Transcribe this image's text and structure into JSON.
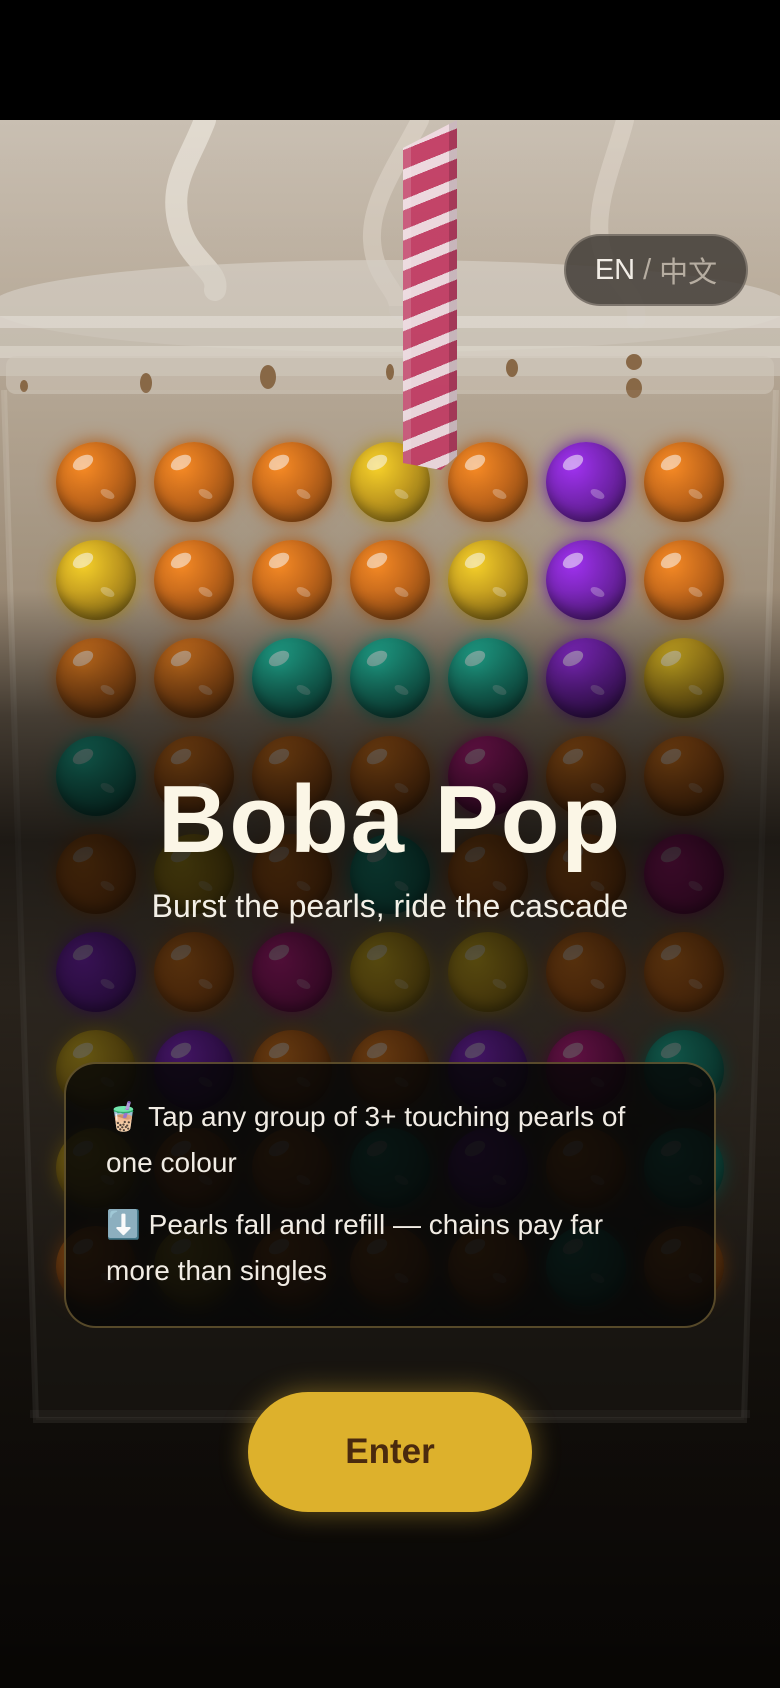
{
  "colors": {
    "orange": "#c86a1c",
    "gold": "#c8a020",
    "teal": "#1e9e86",
    "purple": "#7a26b8",
    "magenta": "#b01e7a",
    "accent": "#ddb12c",
    "straw": "#c44469"
  },
  "board": {
    "rows": [
      [
        "orange",
        "orange",
        "orange",
        "gold",
        "orange",
        "purple",
        "orange"
      ],
      [
        "gold",
        "orange",
        "orange",
        "orange",
        "gold",
        "purple",
        "orange"
      ],
      [
        "orange",
        "orange",
        "teal",
        "teal",
        "teal",
        "purple",
        "gold"
      ],
      [
        "teal",
        "orange",
        "orange",
        "orange",
        "magenta",
        "orange",
        "orange"
      ],
      [
        "orange",
        "gold",
        "orange",
        "teal",
        "orange",
        "orange",
        "magenta"
      ],
      [
        "purple",
        "orange",
        "magenta",
        "gold",
        "gold",
        "orange",
        "orange"
      ],
      [
        "gold",
        "purple",
        "orange",
        "orange",
        "purple",
        "magenta",
        "teal"
      ],
      [
        "gold",
        "orange",
        "orange",
        "teal",
        "purple",
        "orange",
        "teal"
      ],
      [
        "orange",
        "gold",
        "orange",
        "orange",
        "orange",
        "teal",
        "orange"
      ]
    ]
  },
  "lang_toggle": {
    "en": "EN",
    "separator": "/",
    "zh": "中文"
  },
  "title": "Boba Pop",
  "subtitle": "Burst the pearls, ride the cascade",
  "rules": [
    "🧋 Tap any group of 3+ touching pearls of one colour",
    "⬇️ Pearls fall and refill — chains pay far more than singles"
  ],
  "enter_label": "Enter",
  "icons": {
    "straw": "straw-icon",
    "cup": "boba-cup-icon"
  }
}
